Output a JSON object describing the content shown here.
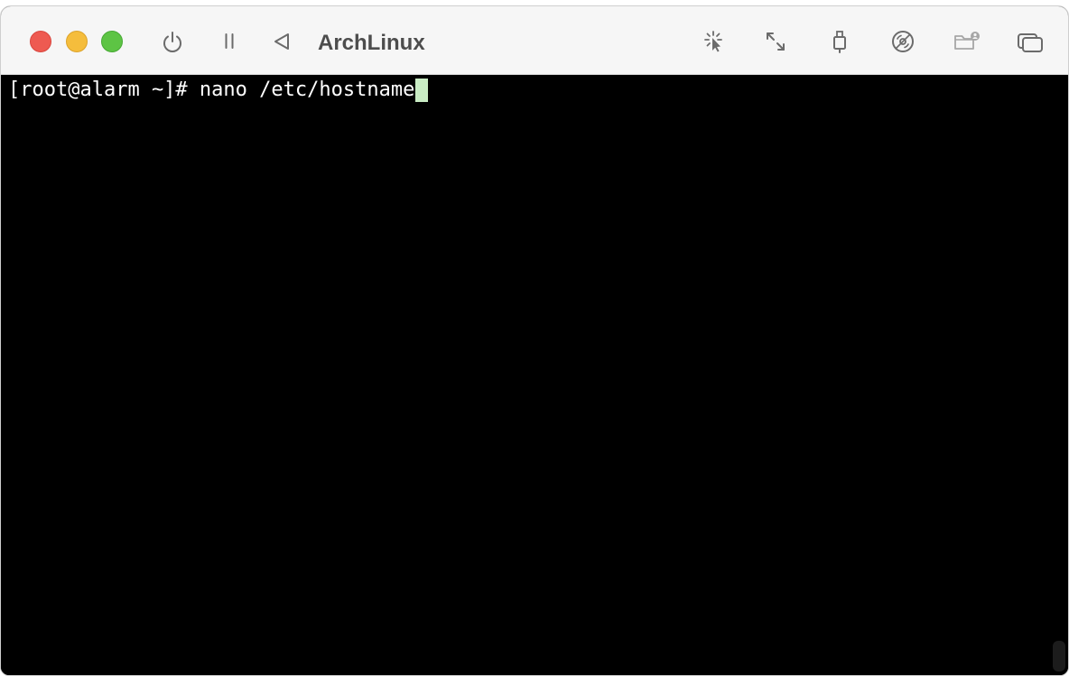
{
  "window": {
    "title": "ArchLinux"
  },
  "toolbar": {
    "left_icons": [
      "power-icon",
      "pause-icon",
      "back-triangle-icon"
    ],
    "right_icons": [
      "capture-cursor-icon",
      "resize-arrows-icon",
      "usb-icon",
      "disc-icon",
      "shared-folder-icon",
      "display-icon"
    ]
  },
  "terminal": {
    "prompt": "[root@alarm ~]# ",
    "command": "nano /etc/hostname",
    "cursor_color": "#c9ecc4",
    "background": "#000000",
    "foreground": "#ffffff"
  },
  "colors": {
    "close": "#ee5a51",
    "minimize": "#f5bd3c",
    "zoom": "#5dc444",
    "titlebar": "#f6f6f6",
    "icon": "#6b6b6b"
  }
}
